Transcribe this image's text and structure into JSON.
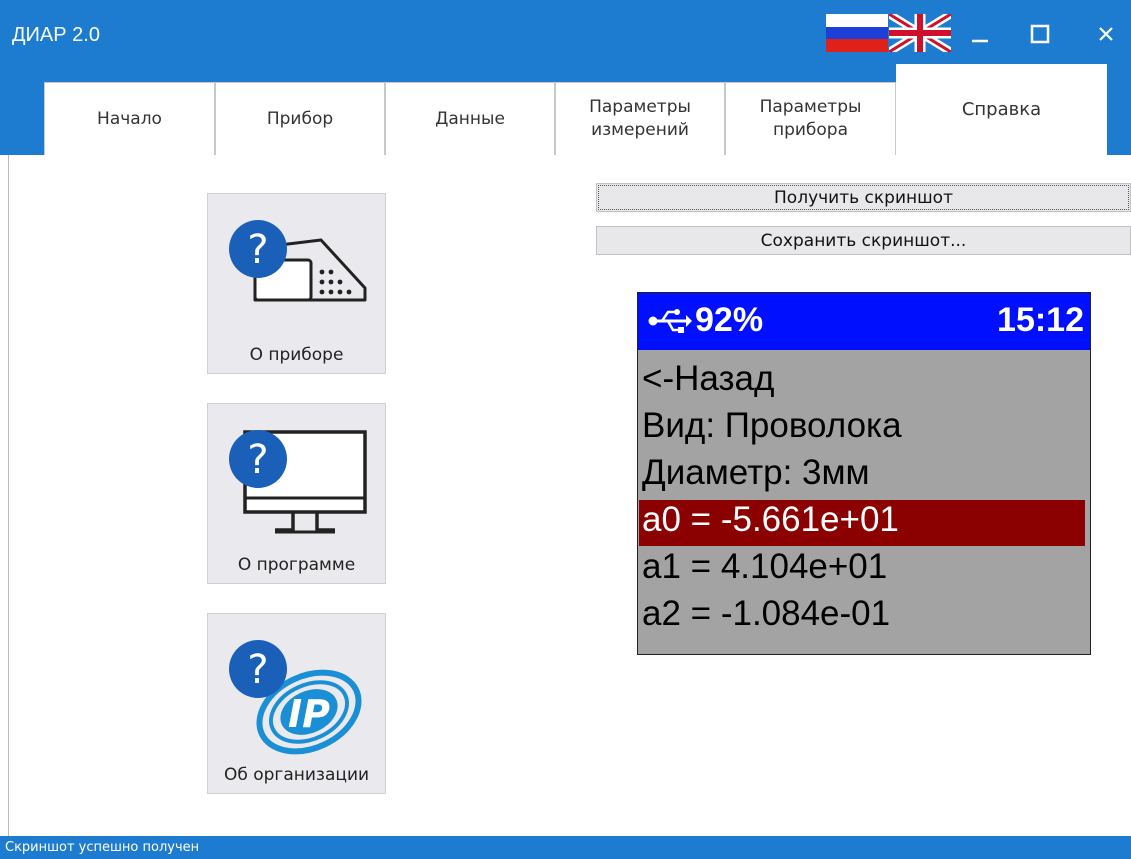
{
  "window": {
    "title": "ДИАР 2.0"
  },
  "colors": {
    "accent": "#1d7cd0",
    "highlight": "#8b0000",
    "device_header": "#0010ff"
  },
  "tabs": [
    {
      "label": "Начало"
    },
    {
      "label": "Прибор"
    },
    {
      "label": "Данные"
    },
    {
      "label": "Параметры\nизмерений"
    },
    {
      "label": "Параметры\nприбора"
    },
    {
      "label": "Справка",
      "active": true
    }
  ],
  "help": {
    "about_device": "О приборе",
    "about_program": "О программе",
    "about_org": "Об организации"
  },
  "actions": {
    "get_screenshot": "Получить скриншот",
    "save_screenshot": "Сохранить скриншот..."
  },
  "device_screen": {
    "battery": "92%",
    "time": "15:12",
    "lines": [
      "<-Назад",
      "Вид: Проволока",
      "Диаметр: 3мм",
      "a0 = -5.661e+01",
      "a1 = 4.104e+01",
      "a2 = -1.084e-01"
    ],
    "selected_index": 3
  },
  "status": {
    "text": "Скриншот успешно получен"
  }
}
